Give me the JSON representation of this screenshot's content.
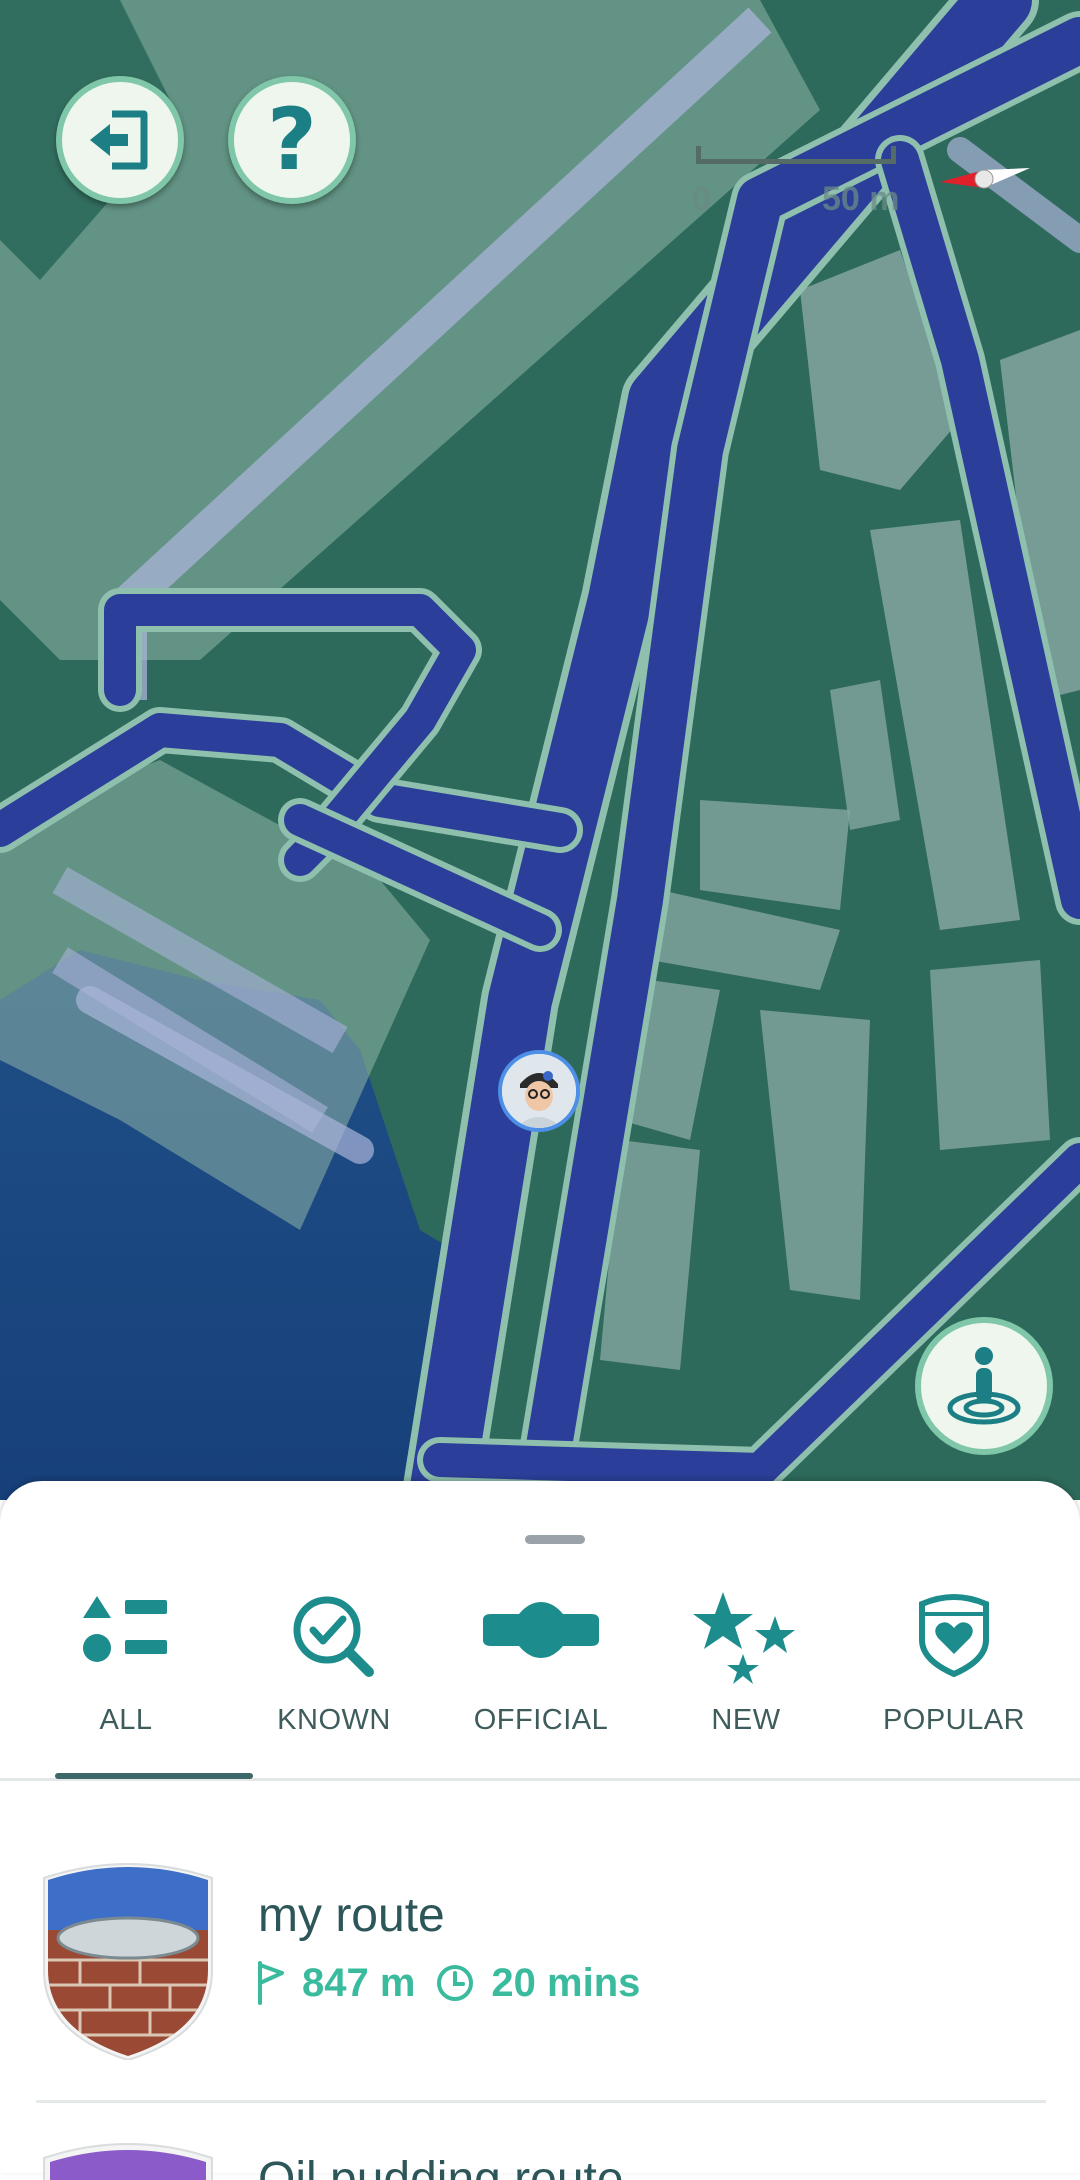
{
  "map": {
    "scale_left": "0",
    "scale_right": "50 m",
    "exit_icon": "exit-door-icon",
    "help_label": "?",
    "recenter_icon": "player-location-icon",
    "compass_icon": "compass-icon"
  },
  "tabs": [
    {
      "label": "ALL",
      "icon": "all-shapes-icon",
      "selected": true
    },
    {
      "label": "KNOWN",
      "icon": "search-check-icon",
      "selected": false
    },
    {
      "label": "OFFICIAL",
      "icon": "official-badge-icon",
      "selected": false
    },
    {
      "label": "NEW",
      "icon": "stars-icon",
      "selected": false
    },
    {
      "label": "POPULAR",
      "icon": "heart-shield-icon",
      "selected": false
    }
  ],
  "routes": [
    {
      "name": "my route",
      "distance": "847 m",
      "duration": "20 mins"
    },
    {
      "name": "Oil pudding route"
    }
  ],
  "colors": {
    "accent": "#1c8c8c",
    "stat_green": "#3bbb9d",
    "road_blue": "#2a3f9a",
    "ground_green": "#2f6a5c"
  }
}
